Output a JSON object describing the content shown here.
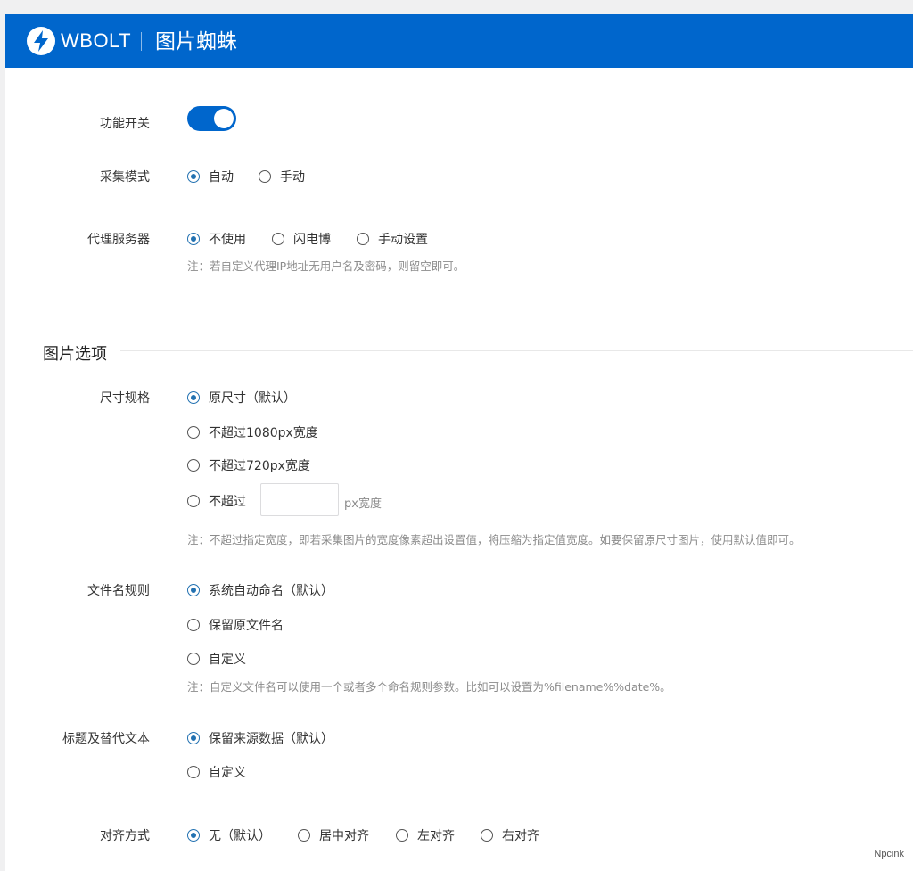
{
  "header": {
    "brand": "WBOLT",
    "plugin_title": "图片蜘蛛",
    "logo_icon": "lightning-bolt-icon",
    "color": "#0066cc"
  },
  "settings": {
    "feature_switch": {
      "label": "功能开关",
      "enabled": true
    },
    "collect_mode": {
      "label": "采集模式",
      "options": [
        "自动",
        "手动"
      ],
      "selected": "自动"
    },
    "proxy": {
      "label": "代理服务器",
      "options": [
        "不使用",
        "闪电博",
        "手动设置"
      ],
      "selected": "不使用",
      "note": "注：若自定义代理IP地址无用户名及密码，则留空即可。"
    }
  },
  "image_options": {
    "section_title": "图片选项",
    "size": {
      "label": "尺寸规格",
      "options": [
        "原尺寸（默认）",
        "不超过1080px宽度",
        "不超过720px宽度",
        "不超过"
      ],
      "selected": "原尺寸（默认）",
      "custom_width_value": "",
      "custom_width_unit": "px宽度",
      "note": "注：不超过指定宽度，即若采集图片的宽度像素超出设置值，将压缩为指定值宽度。如要保留原尺寸图片，使用默认值即可。"
    },
    "filename": {
      "label": "文件名规则",
      "options": [
        "系统自动命名（默认）",
        "保留原文件名",
        "自定义"
      ],
      "selected": "系统自动命名（默认）",
      "note": "注：自定义文件名可以使用一个或者多个命名规则参数。比如可以设置为%filename%%date%。"
    },
    "title_alt": {
      "label": "标题及替代文本",
      "options": [
        "保留来源数据（默认）",
        "自定义"
      ],
      "selected": "保留来源数据（默认）"
    },
    "alignment": {
      "label": "对齐方式",
      "options": [
        "无（默认）",
        "居中对齐",
        "左对齐",
        "右对齐"
      ],
      "selected": "无（默认）"
    }
  },
  "watermark": "Npcink"
}
